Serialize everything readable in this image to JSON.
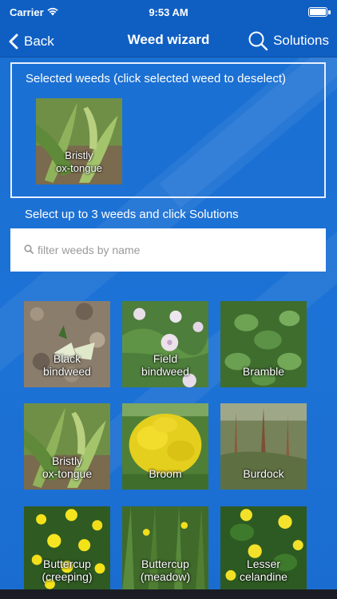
{
  "status_bar": {
    "carrier": "Carrier",
    "time": "9:53 AM"
  },
  "nav": {
    "back_label": "Back",
    "title": "Weed wizard",
    "solutions_label": "Solutions"
  },
  "selected_panel": {
    "title": "Selected weeds (click selected weed to deselect)",
    "items": [
      {
        "label_line1": "Bristly",
        "label_line2": "ox-tongue"
      }
    ]
  },
  "instructions": "Select up to 3 weeds and click Solutions",
  "search": {
    "placeholder": "filter weeds by name",
    "value": ""
  },
  "weeds": [
    {
      "line1": "Black",
      "line2": "bindweed"
    },
    {
      "line1": "Field",
      "line2": "bindweed"
    },
    {
      "line1": "Bramble",
      "line2": ""
    },
    {
      "line1": "Bristly",
      "line2": "ox-tongue"
    },
    {
      "line1": "Broom",
      "line2": ""
    },
    {
      "line1": "Burdock",
      "line2": ""
    },
    {
      "line1": "Buttercup",
      "line2": "(creeping)"
    },
    {
      "line1": "Buttercup",
      "line2": "(meadow)"
    },
    {
      "line1": "Lesser",
      "line2": "celandine"
    }
  ],
  "colors": {
    "accent": "#1a6fd2",
    "bar": "#0f5fc3"
  }
}
